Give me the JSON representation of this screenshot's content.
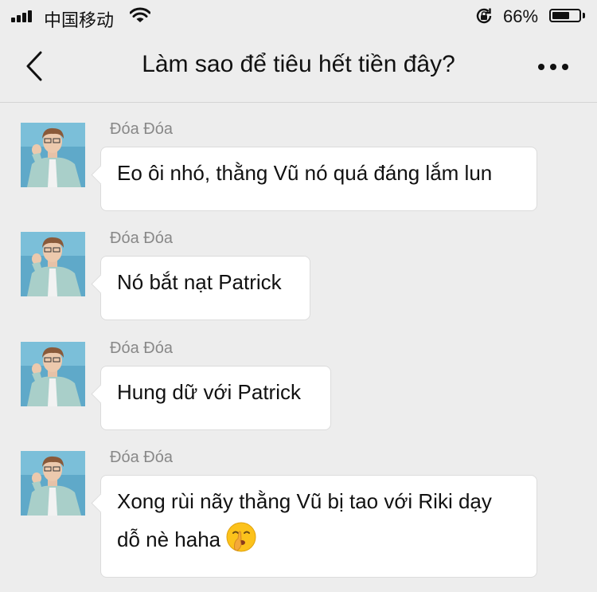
{
  "status_bar": {
    "carrier": "中国移动",
    "battery_percent": "66%",
    "battery_level": 0.66
  },
  "header": {
    "title": "Làm sao để tiêu hết tiền đây?",
    "back_icon": "chevron-left-icon",
    "more_icon": "more-dots-icon"
  },
  "messages": [
    {
      "sender": "Đóa Đóa",
      "text": "Eo ôi nhó, thằng Vũ nó quá đáng lắm lun"
    },
    {
      "sender": "Đóa Đóa",
      "text": "Nó bắt nạt Patrick"
    },
    {
      "sender": "Đóa Đóa",
      "text": "Hung dữ với Patrick"
    },
    {
      "sender": "Đóa Đóa",
      "text_line1": "Xong rùi nãy thằng Vũ bị tao với Riki dạy",
      "text_line2": "dỗ nè haha",
      "emoji": "shushing-face-emoji"
    }
  ],
  "colors": {
    "background": "#ededed",
    "bubble": "#ffffff",
    "sender_name": "#888888",
    "avatar_bg": "#5fa9c9",
    "jacket": "#a9cfc9"
  }
}
